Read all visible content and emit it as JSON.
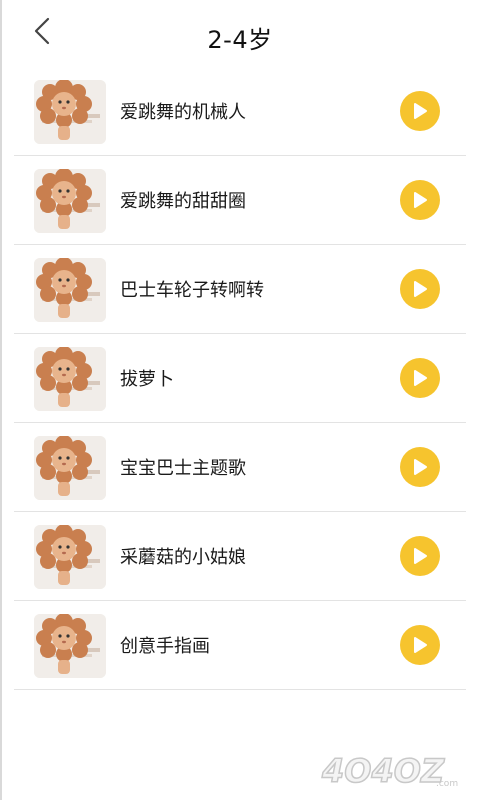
{
  "header": {
    "title": "2-4岁",
    "back_icon": "back-chevron-icon"
  },
  "songs": [
    {
      "title": "爱跳舞的机械人"
    },
    {
      "title": "爱跳舞的甜甜圈"
    },
    {
      "title": "巴士车轮子转啊转"
    },
    {
      "title": "拔萝卜"
    },
    {
      "title": "宝宝巴士主题歌"
    },
    {
      "title": "采蘑菇的小姑娘"
    },
    {
      "title": "创意手指画"
    }
  ],
  "colors": {
    "accent": "#f6c42e",
    "divider": "#e3e3e3"
  },
  "watermark": {
    "text": "4O4OZ.com"
  }
}
